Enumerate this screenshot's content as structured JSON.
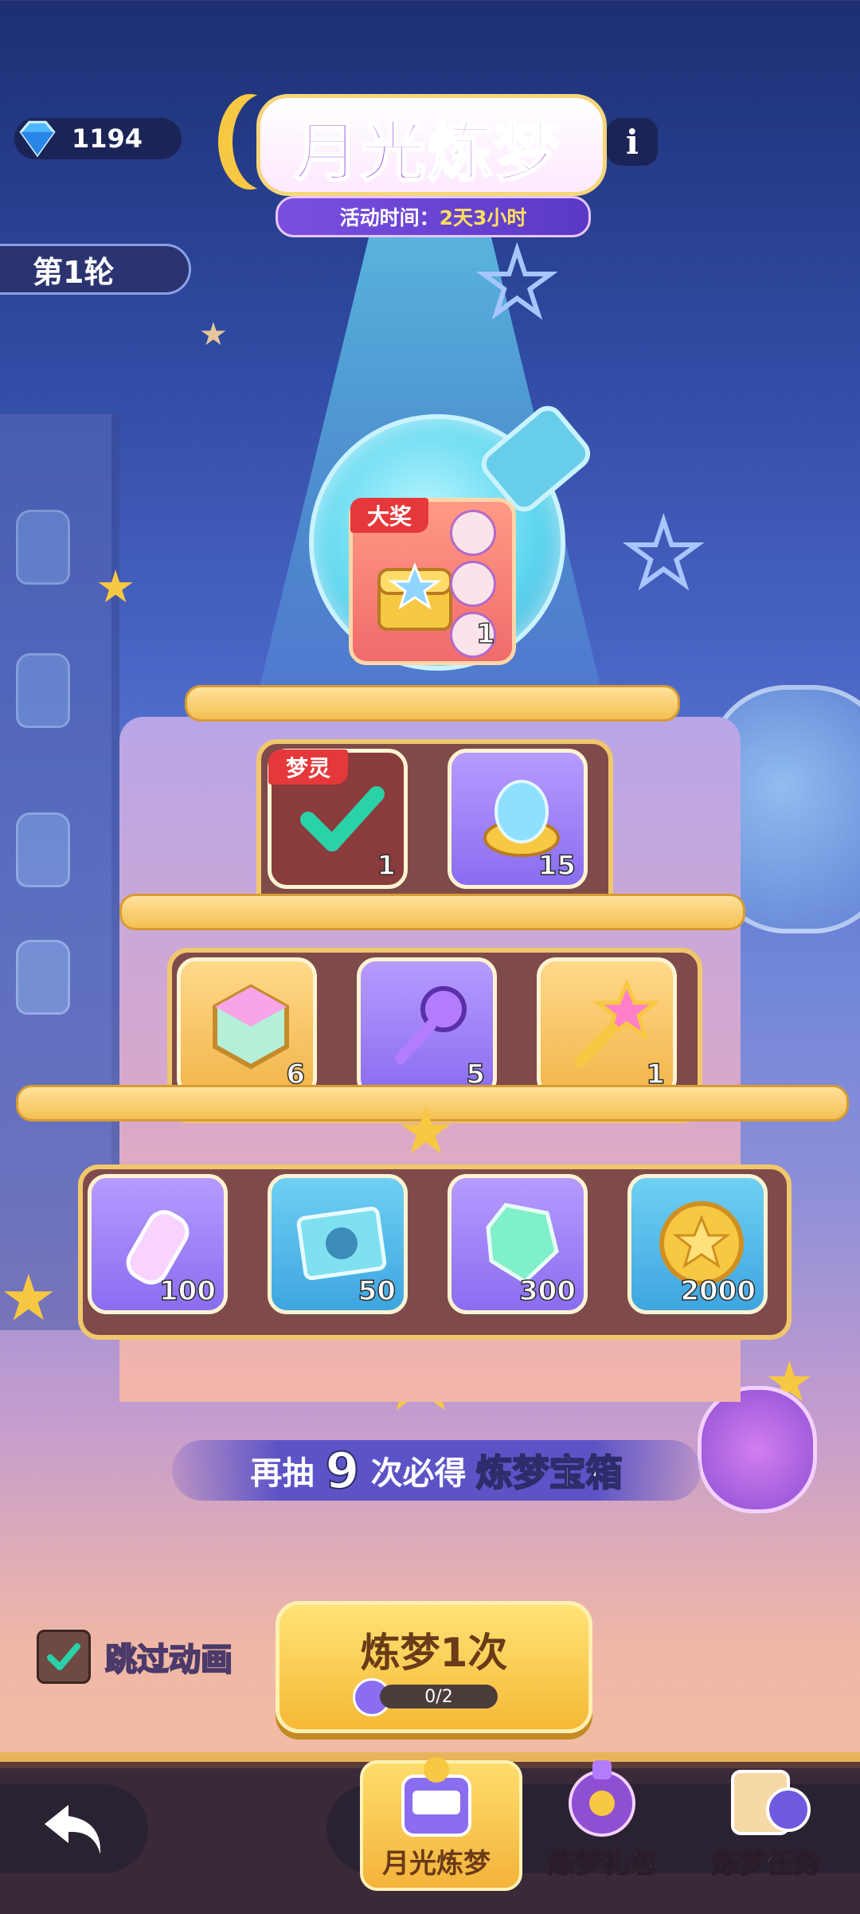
{
  "header": {
    "gems": "1194",
    "title": "月光炼梦",
    "time_label": "活动时间：",
    "time_value": "2天3小时",
    "info_icon": "info-icon",
    "round_label": "第1轮"
  },
  "grand_prize": {
    "tag": "大奖",
    "count": "1"
  },
  "tiers": {
    "top": [
      {
        "tag": "梦灵",
        "count": "1",
        "icon": "check-icon",
        "claimed": true
      },
      {
        "count": "15",
        "icon": "spirit-orb-icon"
      }
    ],
    "middle": [
      {
        "count": "6",
        "icon": "rainbow-cube-icon"
      },
      {
        "count": "5",
        "icon": "purple-key-icon"
      },
      {
        "count": "1",
        "icon": "star-key-icon"
      }
    ],
    "bottom": [
      {
        "count": "100",
        "icon": "rainbow-bottle-icon"
      },
      {
        "count": "50",
        "icon": "blueprint-icon"
      },
      {
        "count": "300",
        "icon": "crystal-icon"
      },
      {
        "count": "2000",
        "icon": "gold-coin-icon"
      }
    ]
  },
  "pity": {
    "prefix": "再抽",
    "number": "9",
    "mid": "次必得",
    "reward": "炼梦宝箱"
  },
  "controls": {
    "skip_label": "跳过动画",
    "skip_checked": true,
    "draw_label": "炼梦1次",
    "draw_cost": "0/2"
  },
  "nav": {
    "tabs": [
      "月光炼梦",
      "炼梦礼包",
      "炼梦任务"
    ],
    "active": 0
  },
  "colors": {
    "accent_purple": "#9a3de0",
    "gold": "#f5b935",
    "red_tag": "#e5383b"
  }
}
